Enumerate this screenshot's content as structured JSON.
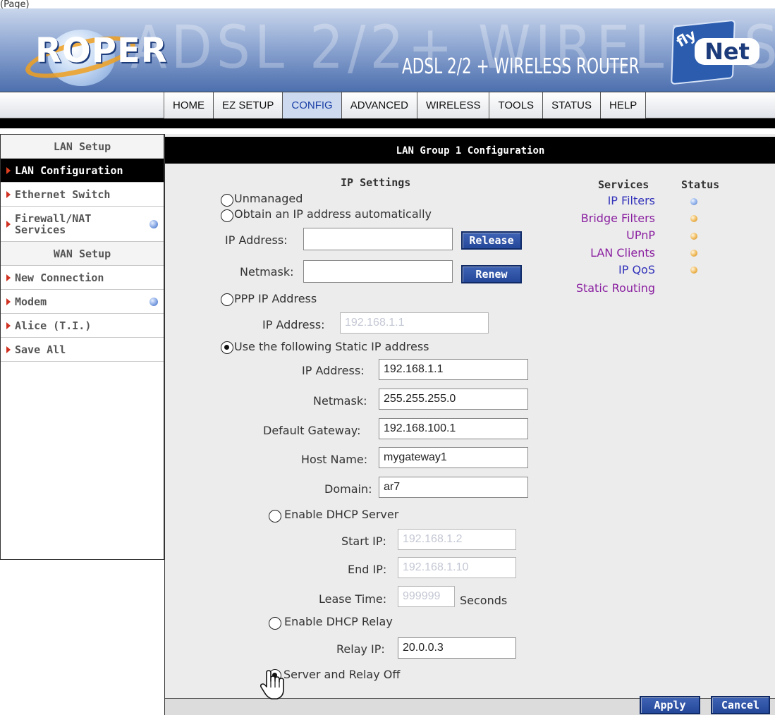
{
  "page_label": "(Page)",
  "banner": {
    "logo_left": "ROPER",
    "watermark": "ADSL 2/2+ WIRELESS ROUTER",
    "title": "ADSL 2/2 + WIRELESS ROUTER",
    "logo_right_fly": "fly",
    "logo_right_net": "Net"
  },
  "nav": {
    "tabs": [
      "HOME",
      "EZ SETUP",
      "CONFIG",
      "ADVANCED",
      "WIRELESS",
      "TOOLS",
      "STATUS",
      "HELP"
    ],
    "active": "CONFIG"
  },
  "sidebar": {
    "lan_header": "LAN Setup",
    "lan_items": [
      "LAN Configuration",
      "Ethernet Switch",
      "Firewall/NAT",
      "Services"
    ],
    "wan_header": "WAN Setup",
    "wan_items": [
      "New Connection",
      "Modem",
      "Alice (T.I.)",
      "Save All"
    ]
  },
  "main": {
    "header": "LAN Group 1 Configuration",
    "ip_settings_title": "IP Settings",
    "unmanaged": "Unmanaged",
    "obtain_auto": "Obtain an IP address automatically",
    "auto_ip_label": "IP Address:",
    "auto_ip_value": "",
    "auto_netmask_label": "Netmask:",
    "auto_netmask_value": "",
    "release_button": "Release",
    "renew_button": "Renew",
    "ppp_label": "PPP IP Address",
    "ppp_ip_label": "IP Address:",
    "ppp_ip_value": "192.168.1.1",
    "static_label": "Use the following Static IP address",
    "static_ip_label": "IP Address:",
    "static_ip_value": "192.168.1.1",
    "static_netmask_label": "Netmask:",
    "static_netmask_value": "255.255.255.0",
    "gateway_label": "Default Gateway:",
    "gateway_value": "192.168.100.1",
    "hostname_label": "Host Name:",
    "hostname_value": "mygateway1",
    "domain_label": "Domain:",
    "domain_value": "ar7",
    "dhcp_server_label": "Enable DHCP Server",
    "start_ip_label": "Start IP:",
    "start_ip_value": "192.168.1.2",
    "end_ip_label": "End IP:",
    "end_ip_value": "192.168.1.10",
    "lease_time_label": "Lease Time:",
    "lease_time_value": "999999",
    "seconds_label": "Seconds",
    "dhcp_relay_label": "Enable DHCP Relay",
    "relay_ip_label": "Relay IP:",
    "relay_ip_value": "20.0.0.3",
    "server_relay_off_label": "Server and Relay Off",
    "apply_button": "Apply",
    "cancel_button": "Cancel"
  },
  "services": {
    "header": "Services",
    "status_header": "Status",
    "items": [
      {
        "name": "IP Filters",
        "color": "#3333bb",
        "status": "blue"
      },
      {
        "name": "Bridge Filters",
        "color": "#8a1fa0",
        "status": "orange"
      },
      {
        "name": "UPnP",
        "color": "#8a1fa0",
        "status": "orange"
      },
      {
        "name": "LAN Clients",
        "color": "#8a1fa0",
        "status": "orange"
      },
      {
        "name": "IP QoS",
        "color": "#3333bb",
        "status": "orange"
      },
      {
        "name": "Static Routing",
        "color": "#8a1fa0",
        "status": ""
      }
    ]
  },
  "colors": {
    "status_blue": "#8fb0ea",
    "status_orange": "#efb857",
    "button_blue": "#2f52a8"
  }
}
